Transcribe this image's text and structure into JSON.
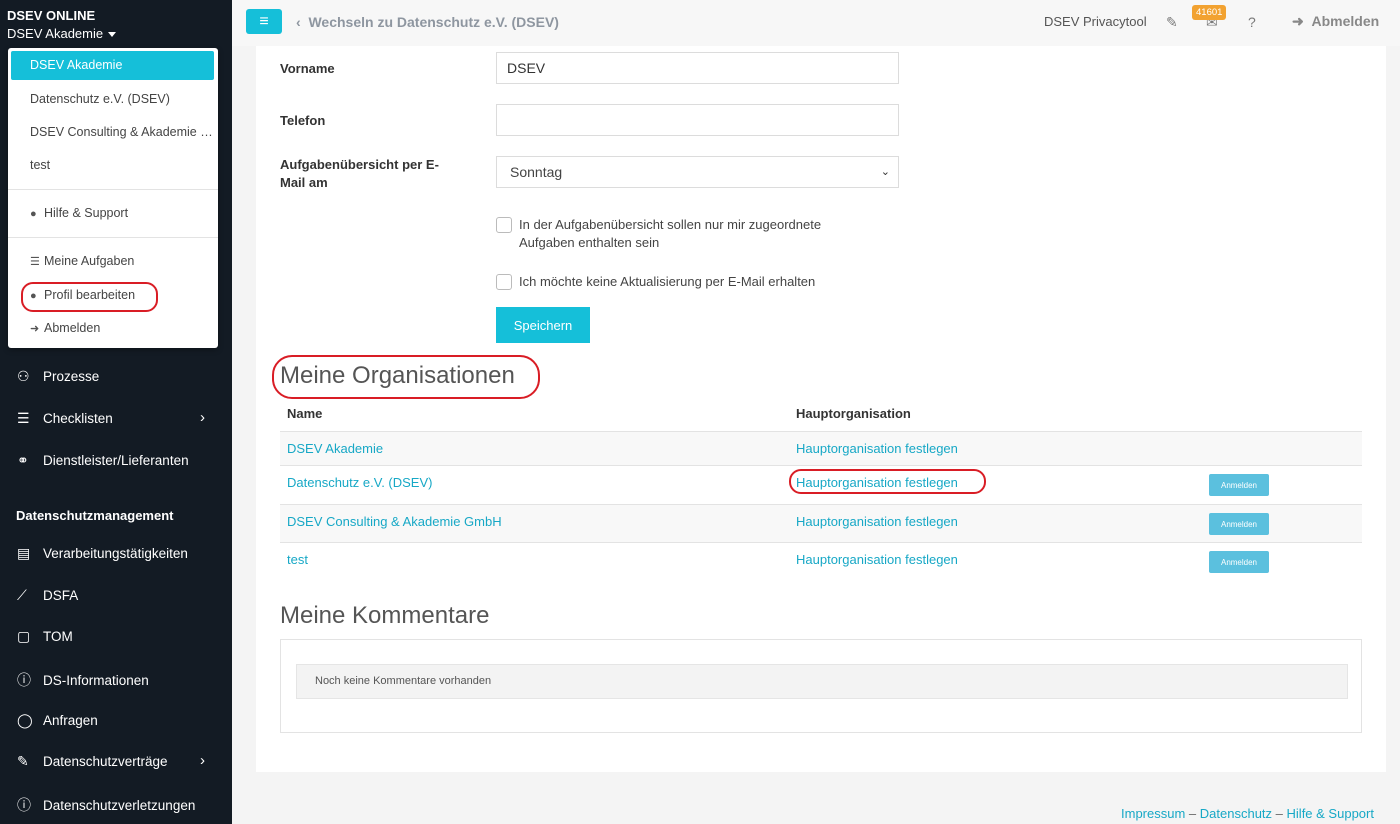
{
  "sidebar": {
    "brand": "DSEV ONLINE",
    "current_org": "DSEV Akademie",
    "dropdown": {
      "orgs": [
        "DSEV Akademie",
        "Datenschutz e.V. (DSEV)",
        "DSEV Consulting & Akademie GmbH",
        "test"
      ],
      "help": "Hilfe & Support",
      "tasks": "Meine Aufgaben",
      "profile": "Profil bearbeiten",
      "logout": "Abmelden"
    },
    "nav": {
      "prozesse": "Prozesse",
      "checklisten": "Checklisten",
      "dienstleister": "Dienstleister/Lieferanten",
      "heading": "Datenschutzmanagement",
      "verarbeitung": "Verarbeitungstätigkeiten",
      "dsfa": "DSFA",
      "tom": "TOM",
      "dsinfo": "DS-Informationen",
      "anfragen": "Anfragen",
      "vertraege": "Datenschutzverträge",
      "verletzungen": "Datenschutzverletzungen"
    }
  },
  "topbar": {
    "switch_link": "Wechseln zu Datenschutz e.V. (DSEV)",
    "tool_label": "DSEV Privacytool",
    "badge": "41601",
    "logout": "Abmelden"
  },
  "form": {
    "vorname_label": "Vorname",
    "vorname_value": "DSEV",
    "telefon_label": "Telefon",
    "telefon_value": "",
    "summary_label_1": "Aufgabenübersicht per E-",
    "summary_label_2": "Mail am",
    "summary_value": "Sonntag",
    "cb1_line1": "In der Aufgabenübersicht sollen nur mir zugeordnete",
    "cb1_line2": "Aufgaben enthalten sein",
    "cb2": "Ich möchte keine Aktualisierung per E-Mail erhalten",
    "save": "Speichern"
  },
  "orgs_section": {
    "title": "Meine Organisationen",
    "col_name": "Name",
    "col_main": "Hauptorganisation",
    "rows": [
      {
        "name": "DSEV Akademie",
        "main": "Hauptorganisation festlegen",
        "button": ""
      },
      {
        "name": "Datenschutz e.V. (DSEV)",
        "main": "Hauptorganisation festlegen",
        "button": "Anmelden"
      },
      {
        "name": "DSEV Consulting & Akademie GmbH",
        "main": "Hauptorganisation festlegen",
        "button": "Anmelden"
      },
      {
        "name": "test",
        "main": "Hauptorganisation festlegen",
        "button": "Anmelden"
      }
    ]
  },
  "comments_section": {
    "title": "Meine Kommentare",
    "empty": "Noch keine Kommentare vorhanden"
  },
  "footer": {
    "impressum": "Impressum",
    "datenschutz": "Datenschutz",
    "hilfe": "Hilfe & Support",
    "sep": "–"
  }
}
